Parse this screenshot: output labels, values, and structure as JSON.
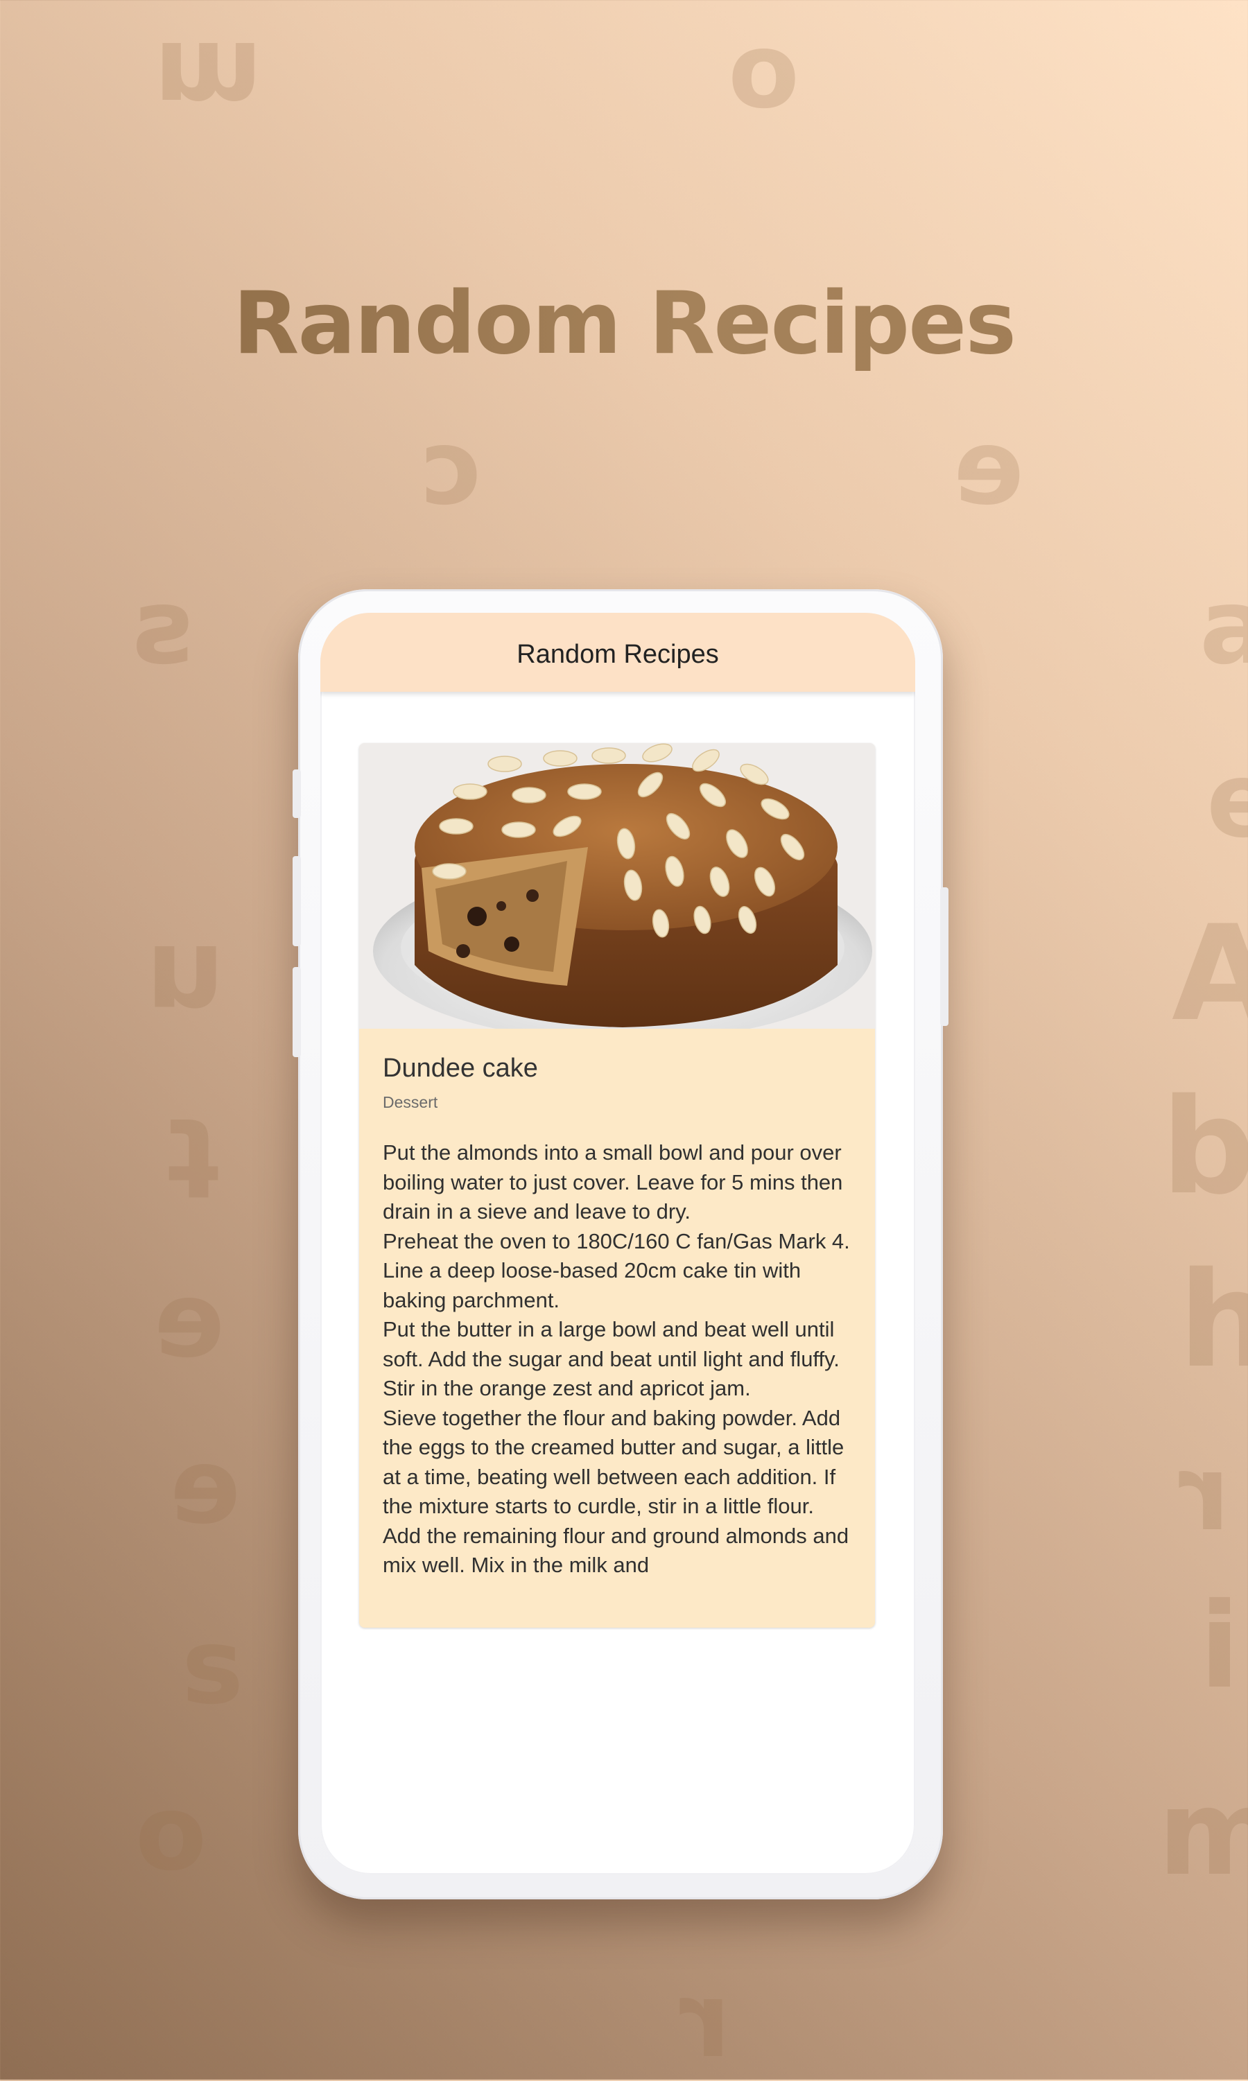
{
  "page": {
    "headline": "Random Recipes",
    "background_letters": [
      "m",
      "o",
      "c",
      "e",
      "s",
      "a",
      "e",
      "n",
      "A",
      "t",
      "b",
      "e",
      "h",
      "e",
      "r",
      "s",
      "i",
      "o",
      "m",
      "r"
    ]
  },
  "app": {
    "title": "Random Recipes",
    "accent_color": "#fde1c6",
    "card_color": "#fde9c7"
  },
  "recipe": {
    "name": "Dundee cake",
    "category": "Dessert",
    "image_icon": "cake-photo",
    "instructions": "Put the almonds into a small bowl and pour over boiling water to just cover. Leave for 5 mins then drain in a sieve and leave to dry.\nPreheat the oven to 180C/160 C fan/Gas Mark 4. Line a deep loose-based 20cm cake tin with baking parchment.\nPut the butter in a large bowl and beat well until soft. Add the sugar and beat until light and fluffy. Stir in the orange zest and apricot jam.\nSieve together the flour and baking powder. Add the eggs to the creamed butter and sugar, a little at a time, beating well between each addition. If the mixture starts to curdle, stir in a little flour.\nAdd the remaining flour and ground almonds and mix well. Mix in the milk and"
  }
}
